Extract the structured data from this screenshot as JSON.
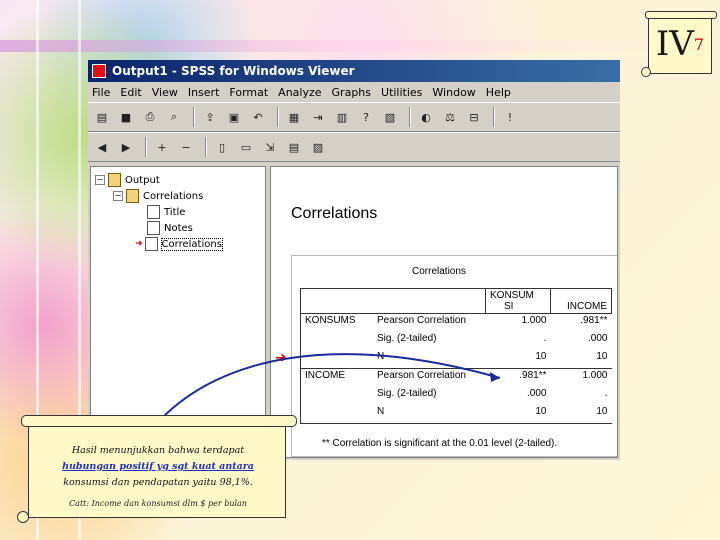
{
  "badge": {
    "roman": "IV",
    "sub": "7"
  },
  "window": {
    "title": "Output1 - SPSS for Windows Viewer",
    "menu": [
      "File",
      "Edit",
      "View",
      "Insert",
      "Format",
      "Analyze",
      "Graphs",
      "Utilities",
      "Window",
      "Help"
    ]
  },
  "tree": {
    "root": "Output",
    "child": "Correlations",
    "items": [
      "Title",
      "Notes",
      "Correlations"
    ]
  },
  "content": {
    "heading": "Correlations",
    "table_title": "Correlations",
    "col_konsum_line1": "KONSUM",
    "col_konsum_line2": "SI",
    "col_income": "INCOME",
    "rows": [
      {
        "var": "KONSUMS",
        "stat": "Pearson Correlation",
        "konsum": "1.000",
        "income": ".981**"
      },
      {
        "var": "",
        "stat": "Sig. (2-tailed)",
        "konsum": ".",
        "income": ".000"
      },
      {
        "var": "",
        "stat": "N",
        "konsum": "10",
        "income": "10"
      },
      {
        "var": "INCOME",
        "stat": "Pearson Correlation",
        "konsum": ".981**",
        "income": "1.000"
      },
      {
        "var": "",
        "stat": "Sig. (2-tailed)",
        "konsum": ".000",
        "income": "."
      },
      {
        "var": "",
        "stat": "N",
        "konsum": "10",
        "income": "10"
      }
    ],
    "footnote": "** Correlation is significant at the 0.01 level (2-tailed)."
  },
  "note": {
    "line1": "Hasil menunjukkan bahwa terdapat",
    "line2_hl": "hubungan positif yg sgt kuat antara",
    "line3": "konsumsi dan pendapatan yaitu 98,1%.",
    "small": "Catt: Income dan konsumsi dlm $ per bulan"
  },
  "colors": {
    "accent_red": "#d00000",
    "title_blue": "#0a246a",
    "note_bg": "#fff8c8"
  }
}
